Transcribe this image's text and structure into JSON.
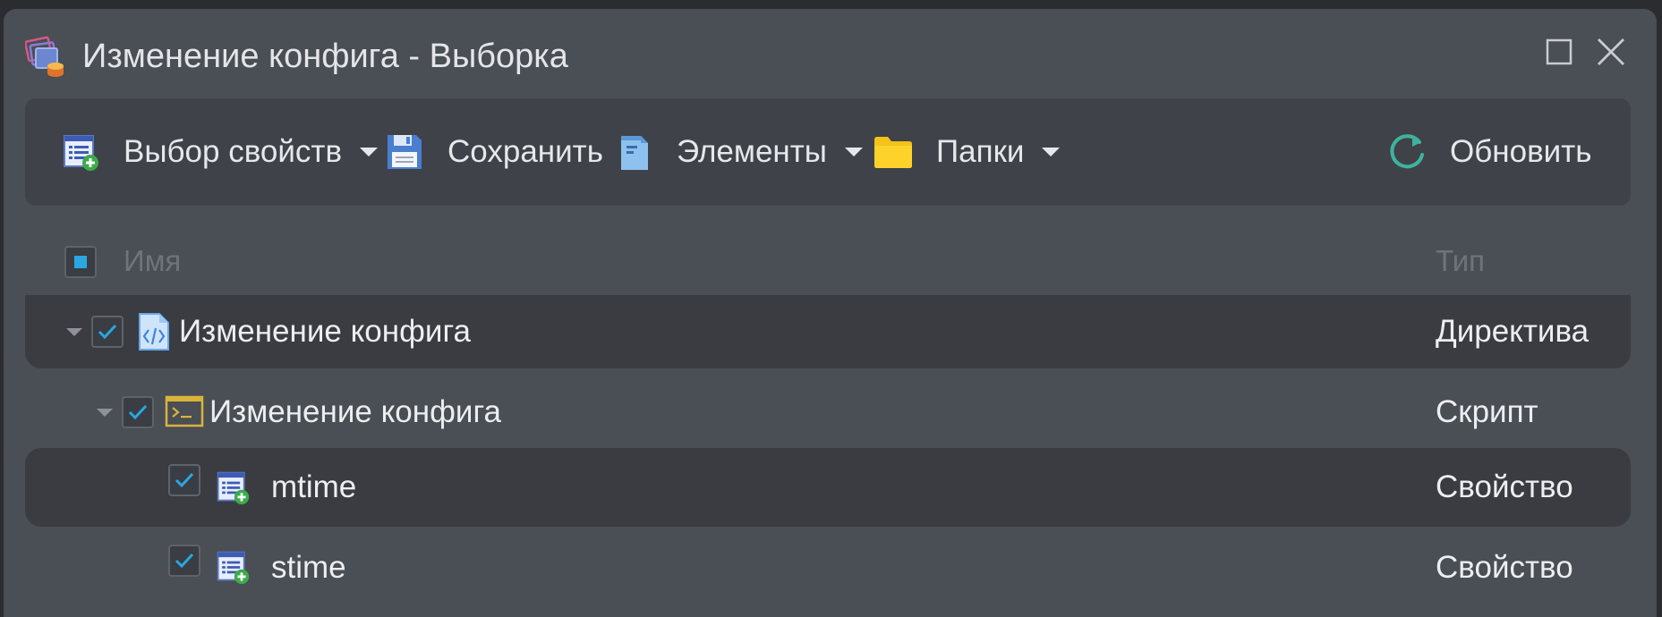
{
  "window": {
    "title": "Изменение конфига - Выборка",
    "app_icon": "stacked-documents-db-icon"
  },
  "toolbar": {
    "select_properties_label": "Выбор свойств",
    "save_label": "Сохранить",
    "elements_label": "Элементы",
    "folders_label": "Папки",
    "refresh_label": "Обновить"
  },
  "table": {
    "columns": {
      "name": "Имя",
      "type": "Тип"
    },
    "rows": [
      {
        "name": "Изменение конфига",
        "type": "Директива",
        "icon": "directive-file-icon",
        "checked": true,
        "expanded": true
      },
      {
        "name": "Изменение конфига",
        "type": "Скрипт",
        "icon": "script-terminal-icon",
        "checked": true,
        "expanded": true
      },
      {
        "name": "mtime",
        "type": "Свойство",
        "icon": "property-add-icon",
        "checked": true
      },
      {
        "name": "stime",
        "type": "Свойство",
        "icon": "property-add-icon",
        "checked": true
      }
    ]
  },
  "colors": {
    "window_bg": "#4a4e55",
    "toolbar_bg": "#3f4349",
    "accent_check": "#2aa7e0",
    "refresh_green": "#3fb39d",
    "folder_yellow": "#f5c318",
    "script_yellow": "#d9b43a"
  }
}
